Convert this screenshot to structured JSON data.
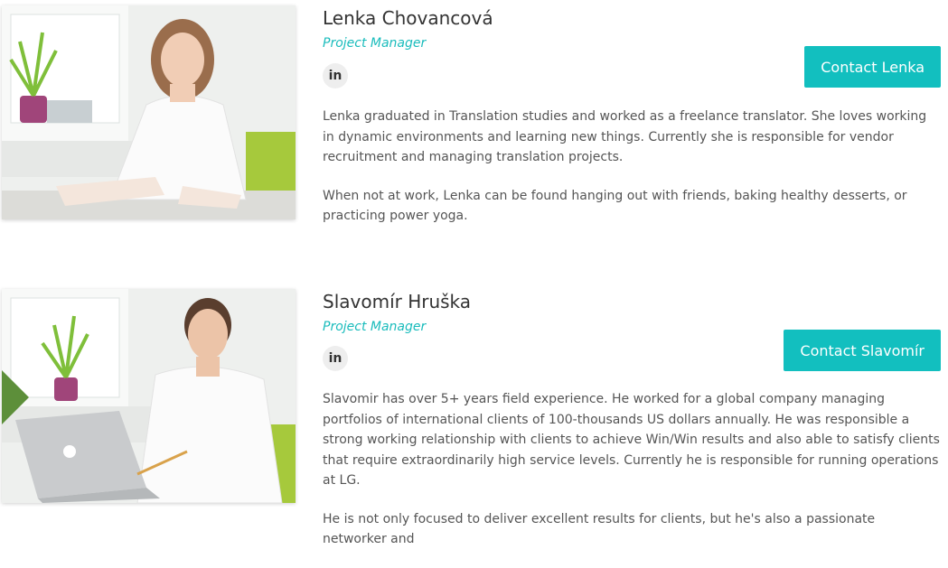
{
  "team": [
    {
      "name": "Lenka Chovancová",
      "role": "Project Manager",
      "social_icon": "linkedin-icon",
      "social_label": "in",
      "contact_label": "Contact Lenka",
      "bio": [
        "Lenka graduated in Translation studies and worked as a freelance translator. She loves working in dynamic environments and learning new things. Currently she is responsible for vendor recruitment and managing translation projects.",
        "When not at work, Lenka can be found hanging out with friends, baking healthy desserts, or practicing power yoga."
      ]
    },
    {
      "name": "Slavomír Hruška",
      "role": "Project Manager",
      "social_icon": "linkedin-icon",
      "social_label": "in",
      "contact_label": "Contact Slavomír",
      "bio": [
        "Slavomir has over 5+ years field experience. He worked for a global company managing portfolios of international clients of 100-thousands US dollars annually. He was responsible a strong working relationship with clients to achieve Win/Win results and also able to satisfy clients that require extraordinarily high service levels. Currently he is responsible for running operations at LG.",
        "He is not only focused to deliver excellent results for clients, but he's also a passionate networker and"
      ]
    }
  ],
  "colors": {
    "accent": "#12bfbf",
    "role_text": "#1abcbc",
    "heading": "#333333",
    "body_text": "#555555"
  }
}
